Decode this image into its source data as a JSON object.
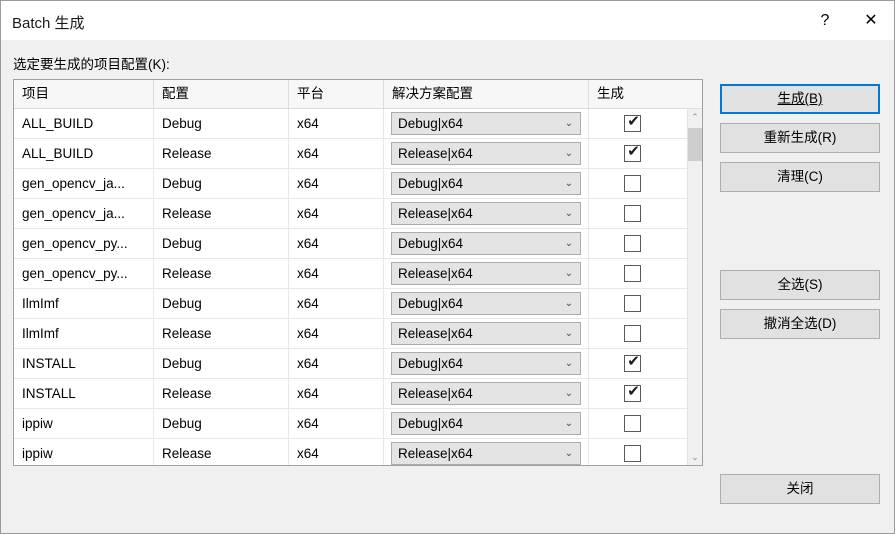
{
  "window": {
    "title": "Batch 生成",
    "help_glyph": "?",
    "close_glyph": "✕"
  },
  "list_label": "选定要生成的项目配置(K):",
  "grid": {
    "columns": [
      "项目",
      "配置",
      "平台",
      "解决方案配置",
      "生成"
    ],
    "rows": [
      {
        "project": "ALL_BUILD",
        "config": "Debug",
        "platform": "x64",
        "solution": "Debug|x64",
        "build": true
      },
      {
        "project": "ALL_BUILD",
        "config": "Release",
        "platform": "x64",
        "solution": "Release|x64",
        "build": true
      },
      {
        "project": "gen_opencv_ja...",
        "config": "Debug",
        "platform": "x64",
        "solution": "Debug|x64",
        "build": false
      },
      {
        "project": "gen_opencv_ja...",
        "config": "Release",
        "platform": "x64",
        "solution": "Release|x64",
        "build": false
      },
      {
        "project": "gen_opencv_py...",
        "config": "Debug",
        "platform": "x64",
        "solution": "Debug|x64",
        "build": false
      },
      {
        "project": "gen_opencv_py...",
        "config": "Release",
        "platform": "x64",
        "solution": "Release|x64",
        "build": false
      },
      {
        "project": "IlmImf",
        "config": "Debug",
        "platform": "x64",
        "solution": "Debug|x64",
        "build": false
      },
      {
        "project": "IlmImf",
        "config": "Release",
        "platform": "x64",
        "solution": "Release|x64",
        "build": false
      },
      {
        "project": "INSTALL",
        "config": "Debug",
        "platform": "x64",
        "solution": "Debug|x64",
        "build": true
      },
      {
        "project": "INSTALL",
        "config": "Release",
        "platform": "x64",
        "solution": "Release|x64",
        "build": true
      },
      {
        "project": "ippiw",
        "config": "Debug",
        "platform": "x64",
        "solution": "Debug|x64",
        "build": false
      },
      {
        "project": "ippiw",
        "config": "Release",
        "platform": "x64",
        "solution": "Release|x64",
        "build": false
      }
    ],
    "checked_glyph": "✔",
    "combo_arrow_glyph": "⌄"
  },
  "scrollbar": {
    "up_glyph": "⌃",
    "down_glyph": "⌄"
  },
  "buttons": {
    "build": "生成(B)",
    "rebuild": "重新生成(R)",
    "clean": "清理(C)",
    "select_all": "全选(S)",
    "deselect_all": "撤消全选(D)",
    "close": "关闭"
  },
  "colors": {
    "focus_border": "#0078d7",
    "dialog_background": "#f0f0f0",
    "button_face": "#e1e1e1",
    "grid_background": "#ffffff",
    "scrollbar_thumb": "#cdcdcd"
  }
}
